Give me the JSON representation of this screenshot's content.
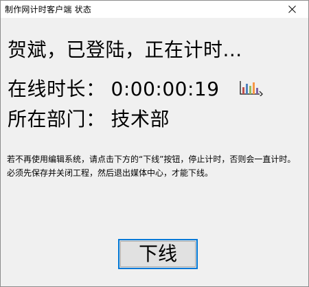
{
  "window": {
    "title": "制作网计时客户端  状态"
  },
  "titlebar": {
    "close_icon": "close-icon"
  },
  "main": {
    "greeting": "贺斌，已登陆，正在计时...",
    "online_label": "在线时长：",
    "online_value": "0:00:00:19",
    "chart_icon": "bar-chart-icon",
    "dept_label": "所在部门：",
    "dept_value": "技术部",
    "notice_line1": "若不再使用编辑系统，请点击下方的“下线”按钮，停止计时，否则会一直计时。",
    "notice_line2": "必须先保存并关闭工程，然后退出媒体中心，才能下线。"
  },
  "footer": {
    "logout_label": "下线"
  },
  "colors": {
    "window_bg": "#f0f0f0",
    "titlebar_bg": "#ffffff",
    "button_border_focus": "#0078d7",
    "button_bg": "#e1e1e1"
  }
}
